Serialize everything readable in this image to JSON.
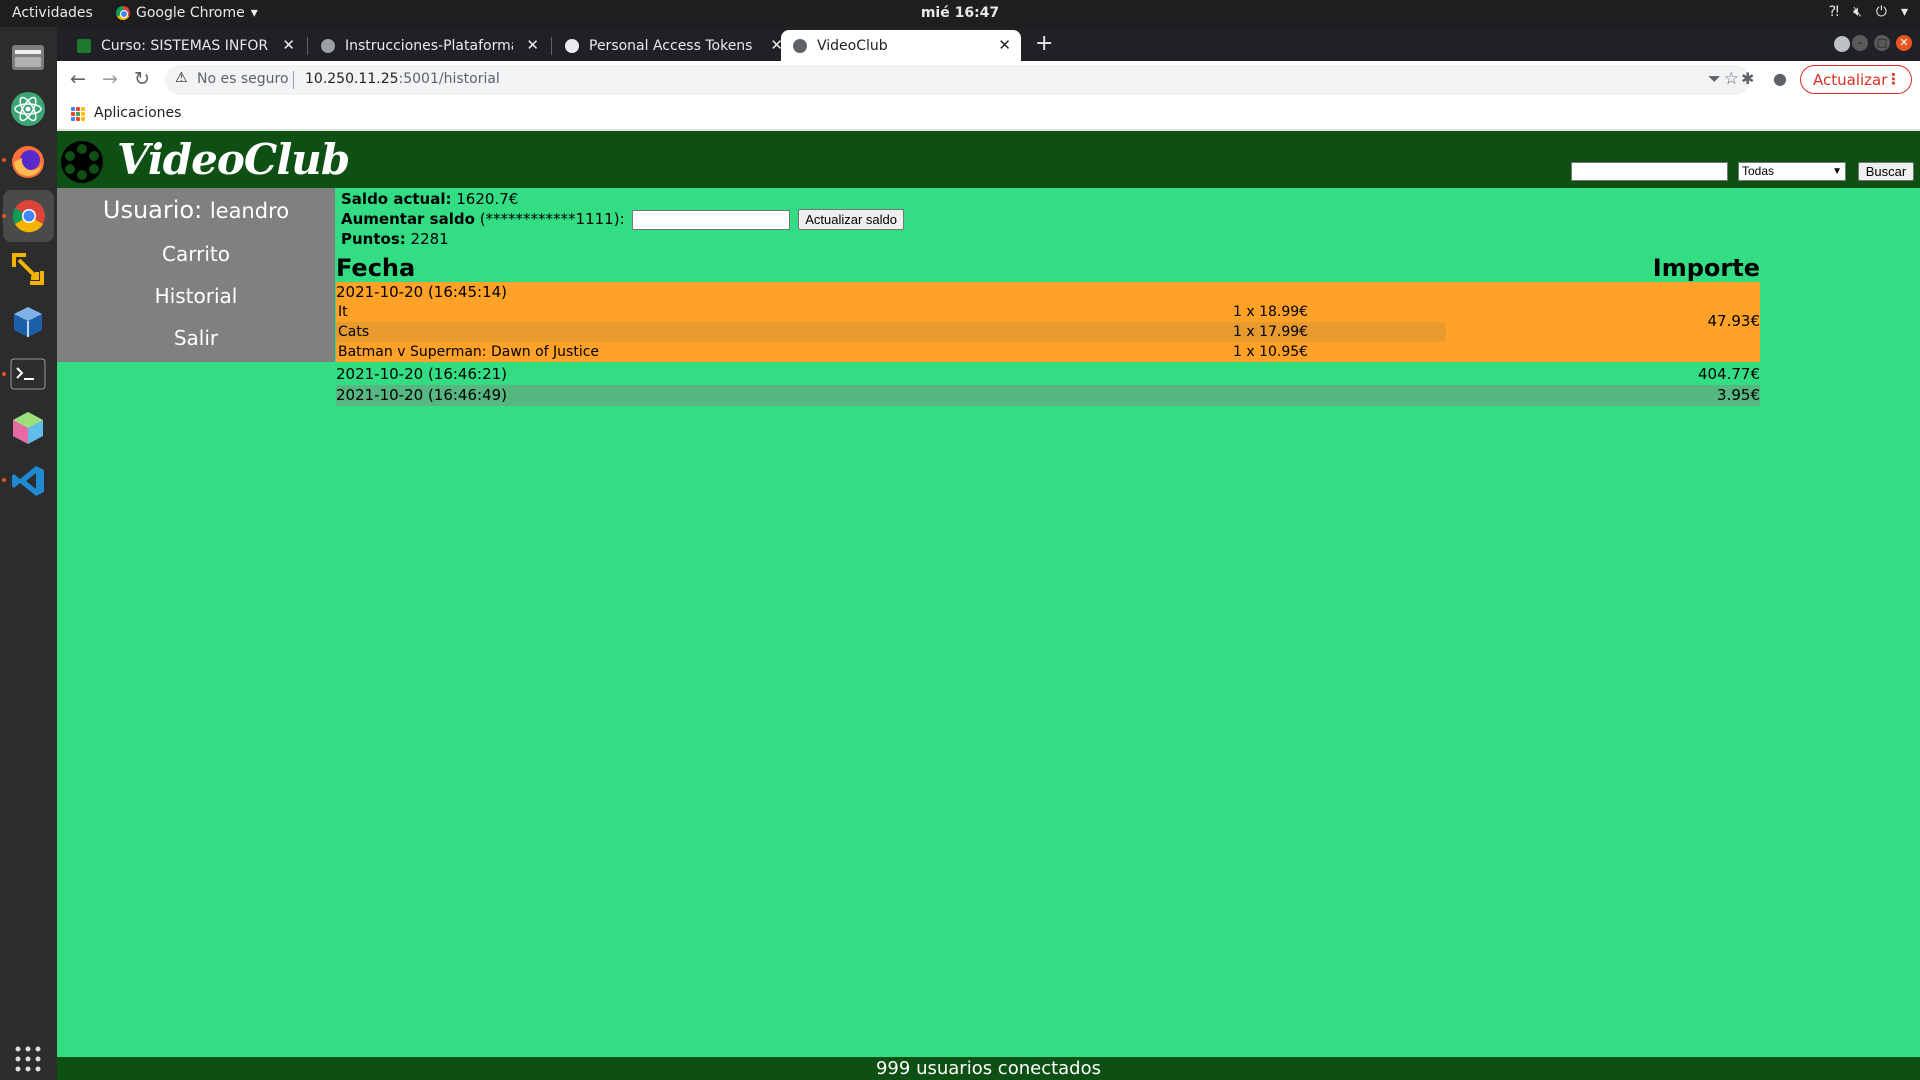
{
  "system": {
    "activities": "Actividades",
    "app_name": "Google Chrome",
    "clock": "mié 16:47"
  },
  "browser": {
    "tabs": [
      {
        "label": "Curso: SISTEMAS INFORM",
        "favicon_color": "#1b7a2c"
      },
      {
        "label": "Instrucciones-Plataforma",
        "favicon_color": "#9aa0a6"
      },
      {
        "label": "Personal Access Tokens",
        "favicon_color": "#e8eaed"
      },
      {
        "label": "VideoClub",
        "favicon_color": "#5f6368"
      }
    ],
    "security_label": "No es seguro",
    "url_host": "10.250.11.25",
    "url_path": ":5001/historial",
    "update_button": "Actualizar",
    "bookmark_apps": "Aplicaciones"
  },
  "site": {
    "logo_text": "VideoClub",
    "search_placeholder": "",
    "category_selected": "Todas",
    "search_button": "Buscar",
    "footer": "999 usuarios conectados"
  },
  "sidebar": {
    "user_label": "Usuario:",
    "username": "leandro",
    "links": [
      "Carrito",
      "Historial",
      "Salir"
    ]
  },
  "account": {
    "balance_label": "Saldo actual:",
    "balance_value": "1620.7€",
    "increase_label": "Aumentar saldo",
    "card_masked": "(************1111):",
    "update_button": "Actualizar saldo",
    "points_label": "Puntos:",
    "points_value": "2281"
  },
  "history": {
    "headers": {
      "date": "Fecha",
      "amount": "Importe"
    },
    "orders": [
      {
        "date": "2021-10-20 (16:45:14)",
        "total": "47.93€",
        "items": [
          {
            "title": "It",
            "qty_price": "1 x 18.99€"
          },
          {
            "title": "Cats",
            "qty_price": "1 x 17.99€"
          },
          {
            "title": "Batman v Superman: Dawn of Justice",
            "qty_price": "1 x 10.95€"
          }
        ]
      },
      {
        "date": "2021-10-20 (16:46:21)",
        "total": "404.77€"
      },
      {
        "date": "2021-10-20 (16:46:49)",
        "total": "3.95€"
      }
    ]
  },
  "colors": {
    "page_bg": "#33dd83",
    "header_bg": "#0e4f13",
    "sidebar_bg": "#808080",
    "order_highlight": "#ffa227"
  }
}
